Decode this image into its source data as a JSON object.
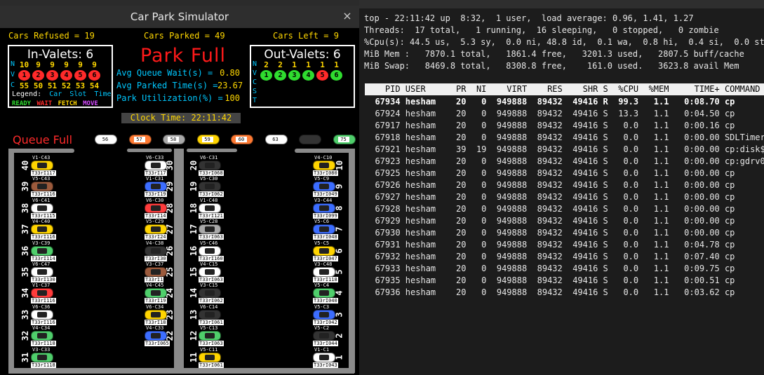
{
  "sim": {
    "title": "Car Park Simulator",
    "close_glyph": "×",
    "cars_refused_label": "Cars Refused = 19",
    "cars_parked_label": "Cars Parked = 49",
    "cars_left_label": "Cars Left = 9",
    "in_valets": {
      "title": "In-Valets: 6",
      "row_labels": [
        "N",
        "V",
        "C"
      ],
      "n_values": [
        "10",
        "9",
        "9",
        "9",
        "9",
        "9"
      ],
      "v_values": [
        "1",
        "2",
        "3",
        "4",
        "5",
        "6"
      ],
      "c_values": [
        "55",
        "50",
        "51",
        "52",
        "53",
        "54"
      ],
      "legend_label": "Legend:",
      "legend_items": [
        "Car",
        "Slot",
        "Time"
      ],
      "status_items": [
        {
          "label": "READY",
          "color": "#2fdc2f"
        },
        {
          "label": "WAIT",
          "color": "#ff2a2a"
        },
        {
          "label": "FETCH",
          "color": "#ffd700"
        },
        {
          "label": "MOVE",
          "color": "#d54bff"
        }
      ]
    },
    "out_valets": {
      "title": "Out-Valets: 6",
      "row_labels": [
        "N",
        "V",
        "C",
        "S",
        "T"
      ],
      "n_values": [
        "2",
        "2",
        "1",
        "1",
        "1",
        "1"
      ],
      "v_values": [
        "1",
        "2",
        "3",
        "4",
        "5",
        "6"
      ]
    },
    "park_full": "Park Full",
    "metrics": [
      {
        "label": "Avg Queue Wait(s) =",
        "value": "0.80"
      },
      {
        "label": "Avg Parked Time(s) =",
        "value": "23.67"
      },
      {
        "label": "Park Utilization(%) =",
        "value": "100"
      }
    ],
    "clock": "Clock Time: 22:11:42",
    "queue_full": "Queue Full",
    "queue_cars": [
      {
        "tag": "56",
        "color": "#ffffff"
      },
      {
        "tag": "57",
        "color": "#ff7a33"
      },
      {
        "tag": "58",
        "color": "#a9a9a9"
      },
      {
        "tag": "59",
        "color": "#ffd400"
      },
      {
        "tag": "60",
        "color": "#ff7a33"
      },
      {
        "tag": "63",
        "color": "#ffffff"
      },
      {
        "tag": "",
        "color": "#333333"
      },
      {
        "tag": "75",
        "color": "#4fce6b"
      }
    ],
    "left_slots": [
      {
        "num": "40",
        "tag": "V1-C43",
        "plate": "T33rI117",
        "color": "#ffd400"
      },
      {
        "num": "39",
        "tag": "V5-C43",
        "plate": "T33rI116",
        "color": "#9b5a3c"
      },
      {
        "num": "38",
        "tag": "V6-C41",
        "plate": "T33rI115",
        "color": "#ffffff"
      },
      {
        "num": "37",
        "tag": "V4-C40",
        "plate": "T33rI116",
        "color": "#ffd400"
      },
      {
        "num": "36",
        "tag": "V3-C39",
        "plate": "T33rI114",
        "color": "#4fce6b"
      },
      {
        "num": "35",
        "tag": "V6-C47",
        "plate": "T33rI130",
        "color": "#ffffff"
      },
      {
        "num": "34",
        "tag": "V1-C37",
        "plate": "T33rI116",
        "color": "#ff3b3b"
      },
      {
        "num": "33",
        "tag": "V6-C36",
        "plate": "T33rI116",
        "color": "#ffffff"
      },
      {
        "num": "32",
        "tag": "V4-C34",
        "plate": "T33rI118",
        "color": "#4fce6b"
      },
      {
        "num": "31",
        "tag": "V3-C33",
        "plate": "T33rI118",
        "color": "#4fce6b"
      }
    ],
    "midleft_slots": [
      {
        "num": "30",
        "tag": "V6-C33",
        "plate": "T33rI17",
        "color": "#ffffff"
      },
      {
        "num": "29",
        "tag": "V1-C31",
        "plate": "T33rI19",
        "color": "#3c6dff"
      },
      {
        "num": "28",
        "tag": "V6-C30",
        "plate": "T33rI14",
        "color": "#ff3b3b"
      },
      {
        "num": "27",
        "tag": "V5-C29",
        "plate": "T33rI24",
        "color": "#ffd400"
      },
      {
        "num": "26",
        "tag": "V4-C38",
        "plate": "T33rI30",
        "color": "#333333"
      },
      {
        "num": "25",
        "tag": "V3-C37",
        "plate": "T33rI1",
        "color": "#9b5a3c"
      },
      {
        "num": "24",
        "tag": "V4-C45",
        "plate": "T33rI19",
        "color": "#4fce6b"
      },
      {
        "num": "23",
        "tag": "V6-C34",
        "plate": "T33rI18",
        "color": "#ffd400"
      },
      {
        "num": "22",
        "tag": "V4-C33",
        "plate": "T33rI065",
        "color": "#3c6dff"
      }
    ],
    "midright_slots": [
      {
        "num": "20",
        "tag": "V6-C31",
        "plate": "T33rI068",
        "color": "#333333"
      },
      {
        "num": "19",
        "tag": "V5-C30",
        "plate": "T33rI062",
        "color": "#333333"
      },
      {
        "num": "18",
        "tag": "V1-C48",
        "plate": "T33rI121",
        "color": "#ffffff"
      },
      {
        "num": "17",
        "tag": "V5-C28",
        "plate": "T33rI063",
        "color": "#a9a9a9"
      },
      {
        "num": "16",
        "tag": "V5-C46",
        "plate": "T33rI160",
        "color": "#ffffff"
      },
      {
        "num": "15",
        "tag": "V4-C15",
        "plate": "T33rI063",
        "color": "#ffffff"
      },
      {
        "num": "14",
        "tag": "V3-C15",
        "plate": "T33rI062",
        "color": "#333333"
      },
      {
        "num": "13",
        "tag": "V6-C14",
        "plate": "T33rI061",
        "color": "#333333"
      },
      {
        "num": "12",
        "tag": "V5-C13",
        "plate": "T33rI063",
        "color": "#4fce6b"
      },
      {
        "num": "11",
        "tag": "V5-C11",
        "plate": "T33rI061",
        "color": "#ffd400"
      }
    ],
    "right_slots": [
      {
        "num": "10",
        "tag": "V4-C10",
        "plate": "T33rI080",
        "color": "#ffd400"
      },
      {
        "num": "9",
        "tag": "V5-C9",
        "plate": "T33rI049",
        "color": "#3c6dff"
      },
      {
        "num": "8",
        "tag": "V3-C44",
        "plate": "T33rI099",
        "color": "#3c6dff"
      },
      {
        "num": "7",
        "tag": "V5-C6",
        "plate": "T33rI048",
        "color": "#3c6dff"
      },
      {
        "num": "6",
        "tag": "V5-C5",
        "plate": "T33rI047",
        "color": "#ffd400"
      },
      {
        "num": "5",
        "tag": "V3-C48",
        "plate": "T33rI118",
        "color": "#ffffff"
      },
      {
        "num": "4",
        "tag": "V5-C4",
        "plate": "T33rI040",
        "color": "#4fce6b"
      },
      {
        "num": "3",
        "tag": "V5-C3",
        "plate": "T33rI042",
        "color": "#3c6dff"
      },
      {
        "num": "2",
        "tag": "V5-C2",
        "plate": "T33rI044",
        "color": "#333333"
      },
      {
        "num": "1",
        "tag": "V1-C1",
        "plate": "T33rI043",
        "color": "#ffffff"
      }
    ]
  },
  "terminal": {
    "summary_lines": [
      "top - 22:11:42 up  8:32,  1 user,  load average: 0.96, 1.41, 1.27",
      "Threads:  17 total,   1 running,  16 sleeping,   0 stopped,   0 zombie",
      "%Cpu(s): 44.5 us,  5.3 sy,  0.0 ni, 48.8 id,  0.1 wa,  0.8 hi,  0.4 si,  0.0 st",
      "MiB Mem :   7870.1 total,   1861.4 free,   3201.3 used,   2807.5 buff/cache",
      "MiB Swap:   8469.8 total,   8308.8 free,    161.0 used.   3623.8 avail Mem"
    ],
    "header": "    PID USER      PR  NI    VIRT    RES    SHR S  %CPU  %MEM     TIME+ COMMAND",
    "processes": [
      {
        "line": "  67934 hesham    20   0  949888  89432  49416 R  99.3   1.1   0:08.70 cp",
        "bold": true
      },
      {
        "line": "  67924 hesham    20   0  949888  89432  49416 S  13.3   1.1   0:04.50 cp",
        "bold": false
      },
      {
        "line": "  67917 hesham    20   0  949888  89432  49416 S   0.0   1.1   0:00.16 cp",
        "bold": false
      },
      {
        "line": "  67918 hesham    20   0  949888  89432  49416 S   0.0   1.1   0:00.00 SDLTimer",
        "bold": false
      },
      {
        "line": "  67921 hesham    39  19  949888  89432  49416 S   0.0   1.1   0:00.00 cp:disk$0",
        "bold": false
      },
      {
        "line": "  67923 hesham    20   0  949888  89432  49416 S   0.0   1.1   0:00.00 cp:gdrv0",
        "bold": false
      },
      {
        "line": "  67925 hesham    20   0  949888  89432  49416 S   0.0   1.1   0:00.00 cp",
        "bold": false
      },
      {
        "line": "  67926 hesham    20   0  949888  89432  49416 S   0.0   1.1   0:00.00 cp",
        "bold": false
      },
      {
        "line": "  67927 hesham    20   0  949888  89432  49416 S   0.0   1.1   0:00.00 cp",
        "bold": false
      },
      {
        "line": "  67928 hesham    20   0  949888  89432  49416 S   0.0   1.1   0:00.00 cp",
        "bold": false
      },
      {
        "line": "  67929 hesham    20   0  949888  89432  49416 S   0.0   1.1   0:00.00 cp",
        "bold": false
      },
      {
        "line": "  67930 hesham    20   0  949888  89432  49416 S   0.0   1.1   0:00.00 cp",
        "bold": false
      },
      {
        "line": "  67931 hesham    20   0  949888  89432  49416 S   0.0   1.1   0:04.78 cp",
        "bold": false
      },
      {
        "line": "  67932 hesham    20   0  949888  89432  49416 S   0.0   1.1   0:07.40 cp",
        "bold": false
      },
      {
        "line": "  67933 hesham    20   0  949888  89432  49416 S   0.0   1.1   0:09.75 cp",
        "bold": false
      },
      {
        "line": "  67935 hesham    20   0  949888  89432  49416 S   0.0   1.1   0:00.51 cp",
        "bold": false
      },
      {
        "line": "  67936 hesham    20   0  949888  89432  49416 S   0.0   1.1   0:03.62 cp",
        "bold": false
      }
    ]
  }
}
